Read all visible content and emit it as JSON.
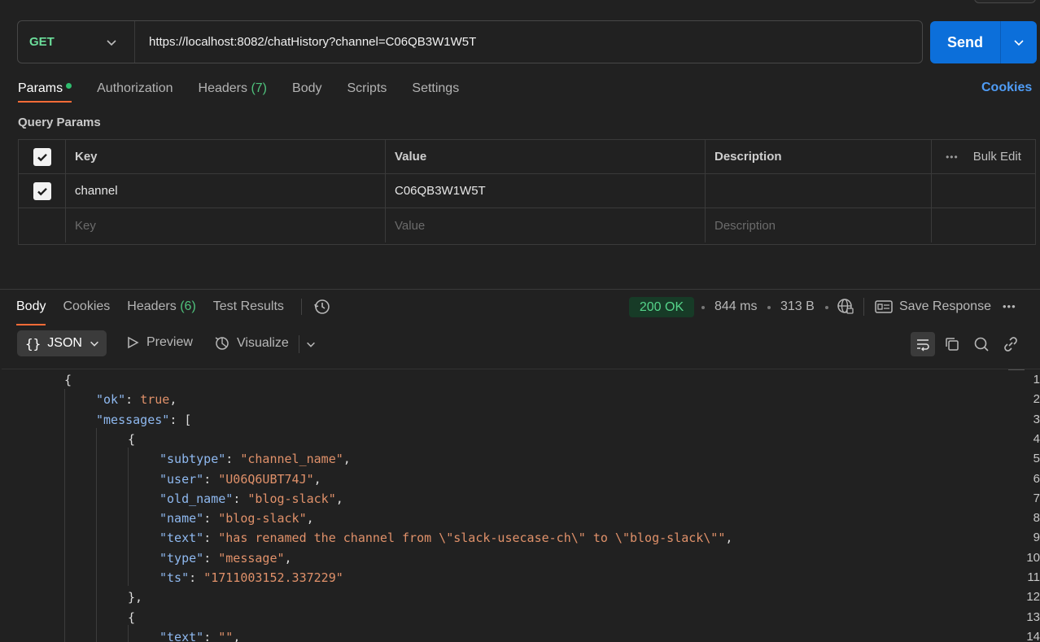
{
  "request": {
    "method": "GET",
    "url": "https://localhost:8082/chatHistory?channel=C06QB3W1W5T",
    "send_label": "Send"
  },
  "request_tabs": {
    "params": "Params",
    "authorization": "Authorization",
    "headers": "Headers",
    "headers_count": "(7)",
    "body": "Body",
    "scripts": "Scripts",
    "settings": "Settings",
    "cookies": "Cookies"
  },
  "query_params": {
    "title": "Query Params",
    "headers": {
      "key": "Key",
      "value": "Value",
      "description": "Description",
      "bulk_edit": "Bulk Edit"
    },
    "rows": [
      {
        "key": "channel",
        "value": "C06QB3W1W5T",
        "description": "",
        "checked": true
      }
    ],
    "placeholder": {
      "key": "Key",
      "value": "Value",
      "description": "Description"
    }
  },
  "response_tabs": {
    "body": "Body",
    "cookies": "Cookies",
    "headers": "Headers",
    "headers_count": "(6)",
    "test_results": "Test Results"
  },
  "response_meta": {
    "status": "200 OK",
    "time": "844 ms",
    "size": "313 B",
    "save_response": "Save Response"
  },
  "format": {
    "json_label": "JSON",
    "preview_label": "Preview",
    "visualize_label": "Visualize"
  },
  "code_lines": [
    {
      "n": "1",
      "t": [
        [
          "p",
          "{"
        ]
      ]
    },
    {
      "n": "2",
      "t": [
        [
          "k",
          "\"ok\""
        ],
        [
          "p",
          ": "
        ],
        [
          "b",
          "true"
        ],
        [
          "p",
          ","
        ]
      ]
    },
    {
      "n": "3",
      "t": [
        [
          "k",
          "\"messages\""
        ],
        [
          "p",
          ": ["
        ]
      ]
    },
    {
      "n": "4",
      "t": [
        [
          "p",
          "{"
        ]
      ]
    },
    {
      "n": "5",
      "t": [
        [
          "k",
          "\"subtype\""
        ],
        [
          "p",
          ": "
        ],
        [
          "s",
          "\"channel_name\""
        ],
        [
          "p",
          ","
        ]
      ]
    },
    {
      "n": "6",
      "t": [
        [
          "k",
          "\"user\""
        ],
        [
          "p",
          ": "
        ],
        [
          "s",
          "\"U06Q6UBT74J\""
        ],
        [
          "p",
          ","
        ]
      ]
    },
    {
      "n": "7",
      "t": [
        [
          "k",
          "\"old_name\""
        ],
        [
          "p",
          ": "
        ],
        [
          "s",
          "\"blog-slack\""
        ],
        [
          "p",
          ","
        ]
      ]
    },
    {
      "n": "8",
      "t": [
        [
          "k",
          "\"name\""
        ],
        [
          "p",
          ": "
        ],
        [
          "s",
          "\"blog-slack\""
        ],
        [
          "p",
          ","
        ]
      ]
    },
    {
      "n": "9",
      "t": [
        [
          "k",
          "\"text\""
        ],
        [
          "p",
          ": "
        ],
        [
          "s",
          "\"has renamed the channel from \\\"slack-usecase-ch\\\" to \\\"blog-slack\\\"\""
        ],
        [
          "p",
          ","
        ]
      ]
    },
    {
      "n": "10",
      "t": [
        [
          "k",
          "\"type\""
        ],
        [
          "p",
          ": "
        ],
        [
          "s",
          "\"message\""
        ],
        [
          "p",
          ","
        ]
      ]
    },
    {
      "n": "11",
      "t": [
        [
          "k",
          "\"ts\""
        ],
        [
          "p",
          ": "
        ],
        [
          "s",
          "\"1711003152.337229\""
        ]
      ]
    },
    {
      "n": "12",
      "t": [
        [
          "p",
          "},"
        ]
      ]
    },
    {
      "n": "13",
      "t": [
        [
          "p",
          "{"
        ]
      ]
    },
    {
      "n": "14",
      "t": [
        [
          "k",
          "\"text\""
        ],
        [
          "p",
          ": "
        ],
        [
          "s",
          "\"\""
        ],
        [
          "p",
          ","
        ]
      ]
    }
  ],
  "icons": {
    "chevron": "chevron-down-icon",
    "history": "history-icon",
    "globe": "globe-lock-icon",
    "save": "save-response-icon",
    "more": "more-icon",
    "wrap": "wrap-lines-icon",
    "copy": "copy-icon",
    "search": "search-icon",
    "link": "link-icon"
  },
  "colors": {
    "accent": "#ff6c37",
    "send": "#0c6fda",
    "status": "#55d48a",
    "method": "#6bdd9a"
  }
}
